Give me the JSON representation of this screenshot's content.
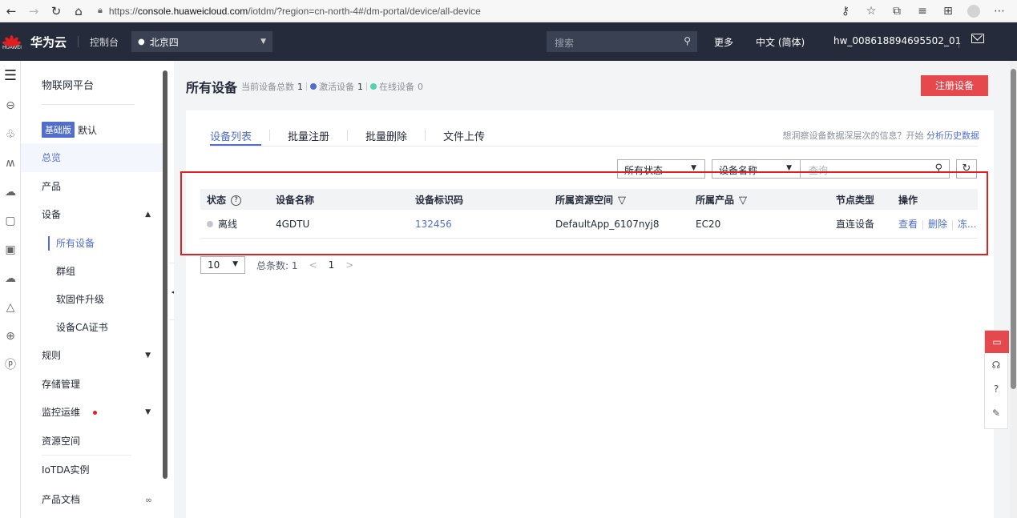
{
  "browser": {
    "url_scheme": "https://",
    "url_domain": "console.huaweicloud.com",
    "url_path": "/iotdm/?region=cn-north-4#/dm-portal/device/all-device"
  },
  "topnav": {
    "logo_text": "HUAWEI",
    "brand": "华为云",
    "console": "控制台",
    "region": "北京四",
    "search_placeholder": "搜索",
    "more": "更多",
    "language": "中文 (简体)",
    "username": "hw_008618894695502_01"
  },
  "sidebar": {
    "title": "物联网平台",
    "edition_badge": "基础版",
    "edition_default": "默认",
    "items": {
      "overview": "总览",
      "product": "产品",
      "device": "设备",
      "all_devices": "所有设备",
      "group": "群组",
      "firmware": "软固件升级",
      "ca_cert": "设备CA证书",
      "rules": "规则",
      "storage": "存储管理",
      "monitor": "监控运维",
      "resource_space": "资源空间",
      "iotda": "IoTDA实例",
      "docs": "产品文档"
    }
  },
  "page": {
    "title": "所有设备",
    "stat_total_label": "当前设备总数",
    "stat_total_value": "1",
    "stat_active_label": "激活设备",
    "stat_active_value": "1",
    "stat_online_label": "在线设备",
    "stat_online_value": "0",
    "register_button": "注册设备",
    "colors": {
      "accent": "#526ecc",
      "danger": "#e5484d",
      "online": "#50d4ab"
    }
  },
  "tabs": [
    "设备列表",
    "批量注册",
    "批量删除",
    "文件上传"
  ],
  "history_hint": "想洞察设备数据深层次的信息？开始",
  "history_link": "分析历史数据",
  "filters": {
    "status": "所有状态",
    "field": "设备名称",
    "query_placeholder": "查询"
  },
  "table": {
    "headers": [
      "状态",
      "设备名称",
      "设备标识码",
      "所属资源空间",
      "所属产品",
      "节点类型",
      "操作"
    ],
    "rows": [
      {
        "status": "离线",
        "name": "4GDTU",
        "id": "132456",
        "space": "DefaultApp_6107nyj8",
        "product": "EC20",
        "node_type": "直连设备",
        "op_view": "查看",
        "op_delete": "删除",
        "op_freeze": "冻..."
      }
    ]
  },
  "pager": {
    "page_size": "10",
    "total_label": "总条数: 1",
    "current_page": "1"
  }
}
